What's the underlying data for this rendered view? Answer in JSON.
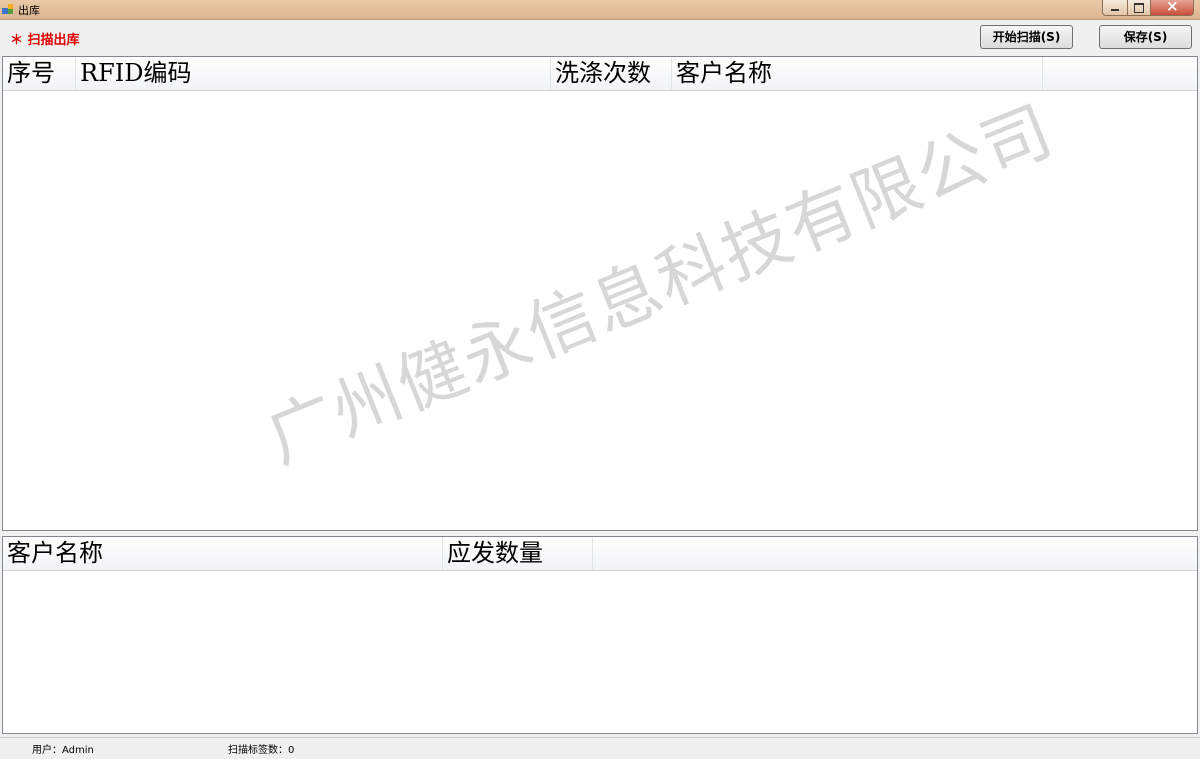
{
  "window": {
    "title": "出库"
  },
  "toolbar": {
    "scan_label": "＊ 扫描出库",
    "start_scan_label": "开始扫描(S)",
    "save_label": "保存(S)"
  },
  "main_grid": {
    "columns": [
      "序号",
      "RFID编码",
      "洗涤次数",
      "客户名称"
    ],
    "rows": []
  },
  "summary_grid": {
    "columns": [
      "客户名称",
      "应发数量"
    ],
    "rows": []
  },
  "watermark": "广州健永信息科技有限公司",
  "status": {
    "user": "用户：Admin",
    "scan_count": "扫描标签数：0"
  },
  "colors": {
    "accent_red": "#e00000",
    "titlebar": "#dcb58f"
  }
}
